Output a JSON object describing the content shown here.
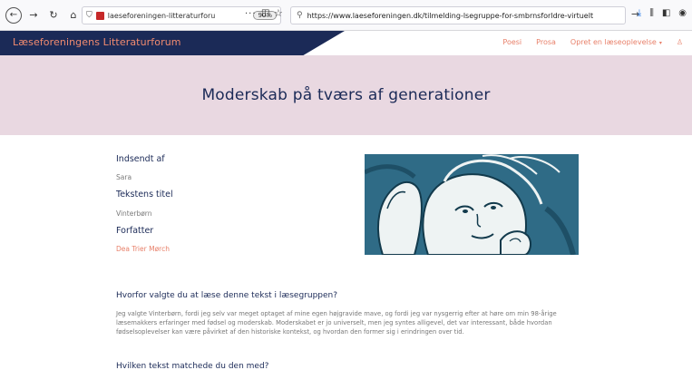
{
  "browser": {
    "tab_text": "laeseforeningen-litteraturforu",
    "zoom": "90%",
    "more": "···",
    "address": "https://www.laeseforeningen.dk/tilmelding-lsegruppe-for-smbrnsforldre-virtuelt"
  },
  "site": {
    "brand": "Læseforeningens Litteraturforum",
    "nav": [
      {
        "label": "Poesi"
      },
      {
        "label": "Prosa"
      },
      {
        "label": "Opret en læseoplevelse"
      }
    ]
  },
  "page": {
    "title": "Moderskab på tværs af generationer",
    "fields": {
      "submitted_by_label": "Indsendt af",
      "submitted_by_value": "Sara",
      "text_title_label": "Tekstens titel",
      "text_title_value": "Vinterbørn",
      "author_label": "Forfatter",
      "author_value": "Dea Trier Mørch"
    },
    "q1": "Hvorfor valgte du at læse denne tekst i læsegruppen?",
    "a1": "Jeg valgte Vinterbørn, fordi jeg selv var meget optaget af mine egen højgravide mave, og fordi jeg var nysgerrig efter at høre om min 98-årige læsemakkers erfaringer med fødsel og moderskab. Moderskabet er jo universelt, men jeg syntes alligevel, det var interessant, både hvordan fødselsoplevelser kan være påvirket af den historiske kontekst, og hvordan den former sig i erindringen over tid.",
    "q2": "Hvilken tekst matchede du den med?"
  },
  "colors": {
    "navy": "#1b2a57",
    "coral": "#e8806a",
    "hero_bg": "#e9d8e1",
    "illustration_bg": "#2f6b86"
  }
}
